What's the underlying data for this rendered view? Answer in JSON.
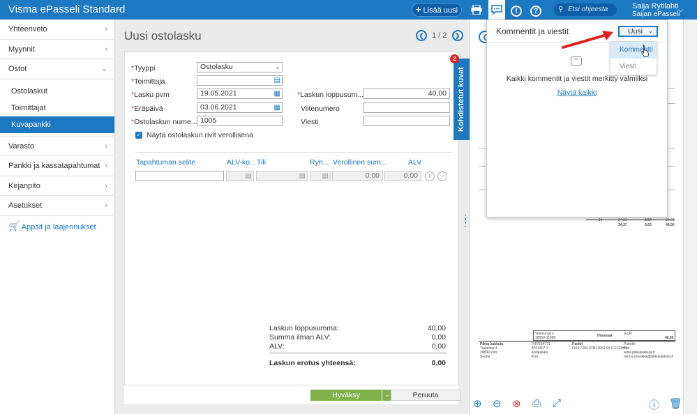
{
  "topbar": {
    "app_title": "Visma ePasseli Standard",
    "add_button": "Lisää uusi",
    "search_placeholder": "Etsi ohjeesta",
    "user_name": "Saija Rytilahti",
    "company": "Saijan ePasseli"
  },
  "sidebar": {
    "items": [
      {
        "label": "Yhteenveto"
      },
      {
        "label": "Myynnit"
      },
      {
        "label": "Ostot"
      }
    ],
    "sub_items": [
      {
        "label": "Ostolaskut"
      },
      {
        "label": "Toimittajat"
      },
      {
        "label": "Kuvapankki"
      }
    ],
    "items_after": [
      {
        "label": "Varasto"
      },
      {
        "label": "Pankki ja kassatapahtumat"
      },
      {
        "label": "Kirjanpito"
      },
      {
        "label": "Asetukset"
      }
    ],
    "apps_label": "Appsit ja laajennukset"
  },
  "main": {
    "title": "Uusi ostolasku",
    "pager": "1 / 2",
    "form": {
      "type_label": "Tyyppi",
      "type_value": "Ostolasku",
      "supplier_label": "Toimittaja",
      "supplier_value": "",
      "invoice_date_label": "Lasku pvm",
      "invoice_date_value": "19.05.2021",
      "due_date_label": "Eräpäivä",
      "due_date_value": "03.06.2021",
      "invoice_number_label": "Ostolaskun nume...",
      "invoice_number_value": "1005",
      "total_label": "Laskun loppusum...",
      "total_value": "40,00",
      "reference_label": "Viitenumero",
      "reference_value": "",
      "message_label": "Viesti",
      "message_value": "",
      "checkbox_label": "Näytä ostolaskun rivit verollisena"
    },
    "rows_header": {
      "description": "Tapahtuman selite",
      "vat_code": "ALV-ko...",
      "account": "Tili",
      "group": "Ryh...",
      "gross_amount": "Verollinen sum...",
      "vat": "ALV"
    },
    "row": {
      "gross_amount": "0,00",
      "vat": "0,00"
    },
    "summary": [
      {
        "label": "Laskun loppusumma:",
        "value": "40,00"
      },
      {
        "label": "Summa ilman ALV:",
        "value": "0,00"
      },
      {
        "label": "ALV:",
        "value": "0,00"
      }
    ],
    "difference": {
      "label": "Laskun erotus yhteensä:",
      "value": "0,00"
    },
    "approve_button": "Hyväksy",
    "cancel_button": "Peruuta"
  },
  "side_tab": {
    "label": "Kohdistetut kuvat",
    "badge": "2"
  },
  "comments_popup": {
    "title": "Kommentit ja viestit",
    "dropdown_value": "Uusi",
    "options": [
      "Kommentti",
      "Viesti"
    ],
    "message": "Kaikki kommentit ja viestit merkitty valmiiksi",
    "show_all_link": "Näytä kaikki"
  },
  "preview_doc": {
    "ref_label": "Viitenumero",
    "ref_value": "10050 01058",
    "total_label": "Yhteensä",
    "currency": "EUR",
    "total_value": "40,00",
    "company": "Pikku kakkula",
    "address1": "Tuulentie 4",
    "address2": "28800 Pori",
    "country": "Suomi",
    "col2a": "FI87654771",
    "col2b": "8702407-3",
    "col2c": "Kotipaikka",
    "col2d": "Pori",
    "bank_label": "Pankit",
    "bank_line": "FI02 7394 0780 4052 93 ITELFIHH",
    "phone_label": "Puhelin",
    "fax_label": "Fax",
    "web": "www.pikkukakkula.fi",
    "email": "minna.musikka@pikkukakkula.fi",
    "row_a": "14",
    "row_b": "24,31",
    "row_c": "3,60",
    "row_d": "30,00",
    "row_e": "34,37",
    "row_f": "5,63",
    "row_g": "40,00"
  }
}
